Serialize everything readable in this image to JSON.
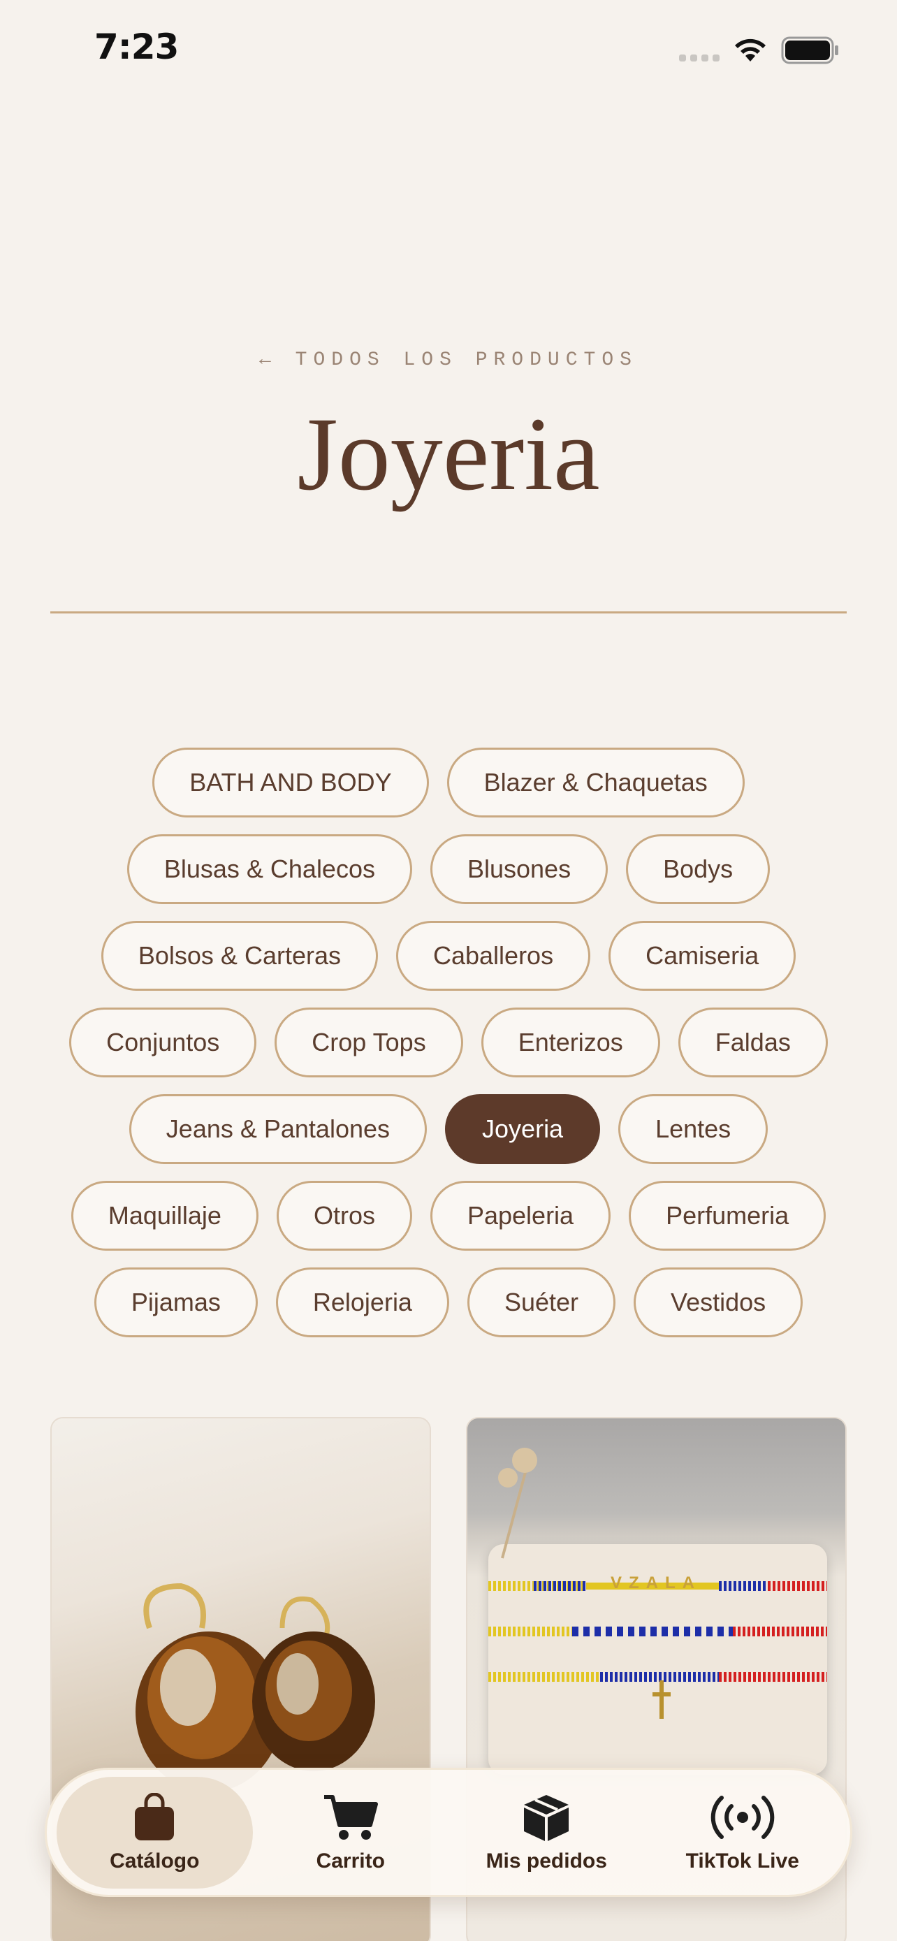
{
  "status_bar": {
    "time": "7:23",
    "icons": [
      "cellular-signal-icon",
      "wifi-icon",
      "battery-icon"
    ]
  },
  "header": {
    "back_link": "← TODOS LOS PRODUCTOS",
    "title": "Joyeria"
  },
  "categories": {
    "rows": [
      [
        "BATH AND BODY",
        "Blazer & Chaquetas"
      ],
      [
        "Blusas & Chalecos",
        "Blusones",
        "Bodys"
      ],
      [
        "Bolsos & Carteras",
        "Caballeros",
        "Camiseria"
      ],
      [
        "Conjuntos",
        "Crop Tops",
        "Enterizos",
        "Faldas"
      ],
      [
        "Jeans & Pantalones",
        "Joyeria",
        "Lentes"
      ],
      [
        "Maquillaje",
        "Otros",
        "Papeleria",
        "Perfumeria"
      ],
      [
        "Pijamas",
        "Relojeria",
        "Suéter",
        "Vestidos"
      ]
    ],
    "selected": "Joyeria"
  },
  "products": {
    "left_image": "amber-hoop-earrings-photo",
    "right_image": "beaded-bracelets-photo",
    "right_beads_text": "VZALA"
  },
  "tab_bar": {
    "tabs": [
      {
        "label": "Catálogo",
        "icon": "shopping-bag-icon",
        "active": true
      },
      {
        "label": "Carrito",
        "icon": "cart-icon",
        "active": false
      },
      {
        "label": "Mis pedidos",
        "icon": "package-icon",
        "active": false
      },
      {
        "label": "TikTok Live",
        "icon": "broadcast-icon",
        "active": false
      }
    ]
  },
  "colors": {
    "background": "#f6f2ed",
    "accent": "#5d3a2a",
    "chip_border": "#c9a982"
  }
}
